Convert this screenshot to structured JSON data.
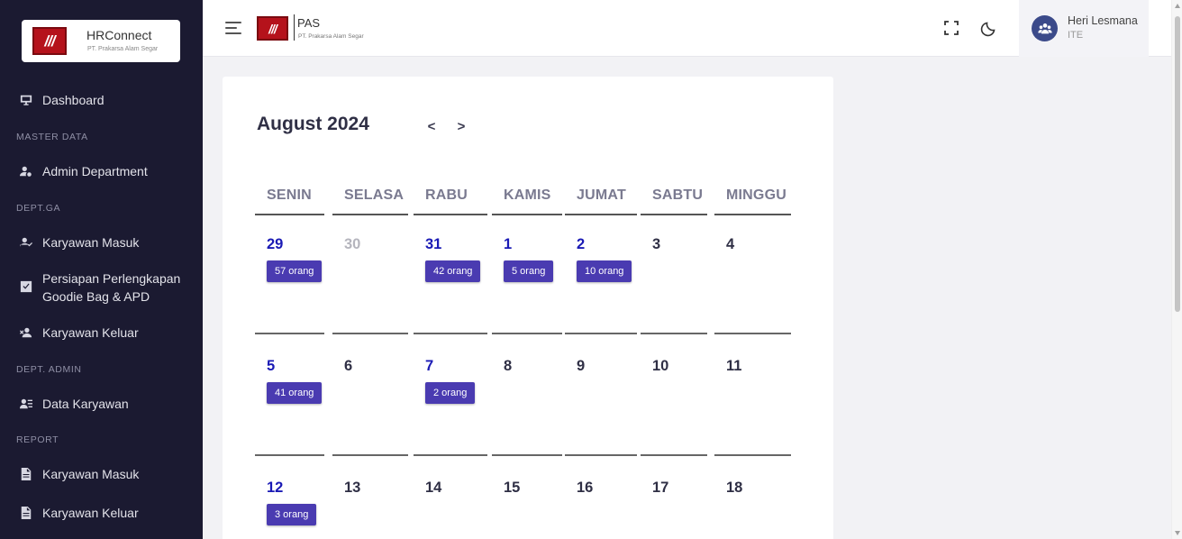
{
  "sidebar": {
    "logo_title": "HRConnect",
    "logo_subtitle": "PT. Prakarsa Alam Segar",
    "logo_mark": "///",
    "items": [
      {
        "label": "Dashboard",
        "icon": "monitor-icon"
      },
      {
        "section": "MASTER DATA"
      },
      {
        "label": "Admin Department",
        "icon": "user-gear-icon"
      },
      {
        "section": "DEPT.GA"
      },
      {
        "label": "Karyawan Masuk",
        "icon": "user-check-icon"
      },
      {
        "label": "Persiapan Perlengkapan Goodie Bag & APD",
        "icon": "checkbox-icon"
      },
      {
        "label": "Karyawan Keluar",
        "icon": "user-remove-icon"
      },
      {
        "section": "DEPT. ADMIN"
      },
      {
        "label": "Data Karyawan",
        "icon": "user-list-icon"
      },
      {
        "section": "REPORT"
      },
      {
        "label": "Karyawan Masuk",
        "icon": "document-icon"
      },
      {
        "label": "Karyawan Keluar",
        "icon": "document-icon"
      }
    ]
  },
  "topbar": {
    "brand_title": "PAS",
    "brand_subtitle": "PT. Prakarsa Alam Segar",
    "brand_mark": "///",
    "user_name": "Heri Lesmana",
    "user_role": "ITE"
  },
  "calendar": {
    "month_title": "August 2024",
    "prev_label": "<",
    "next_label": ">",
    "days_of_week": [
      "SENIN",
      "SELASA",
      "RABU",
      "KAMIS",
      "JUMAT",
      "SABTU",
      "MINGGU"
    ],
    "weeks": [
      [
        {
          "day": "29",
          "event": "57 orang"
        },
        {
          "day": "30",
          "muted": true
        },
        {
          "day": "31",
          "event": "42 orang"
        },
        {
          "day": "1",
          "event": "5 orang"
        },
        {
          "day": "2",
          "event": "10 orang"
        },
        {
          "day": "3"
        },
        {
          "day": "4"
        }
      ],
      [
        {
          "day": "5",
          "event": "41 orang"
        },
        {
          "day": "6"
        },
        {
          "day": "7",
          "event": "2 orang"
        },
        {
          "day": "8"
        },
        {
          "day": "9"
        },
        {
          "day": "10"
        },
        {
          "day": "11"
        }
      ],
      [
        {
          "day": "12",
          "event": "3 orang"
        },
        {
          "day": "13"
        },
        {
          "day": "14"
        },
        {
          "day": "15"
        },
        {
          "day": "16"
        },
        {
          "day": "17"
        },
        {
          "day": "18"
        }
      ]
    ]
  },
  "colors": {
    "sidebar_bg": "#1b1a31",
    "badge_bg": "#4a3bb1",
    "event_day": "#1a1ab5",
    "brand_red": "#b5121b"
  }
}
